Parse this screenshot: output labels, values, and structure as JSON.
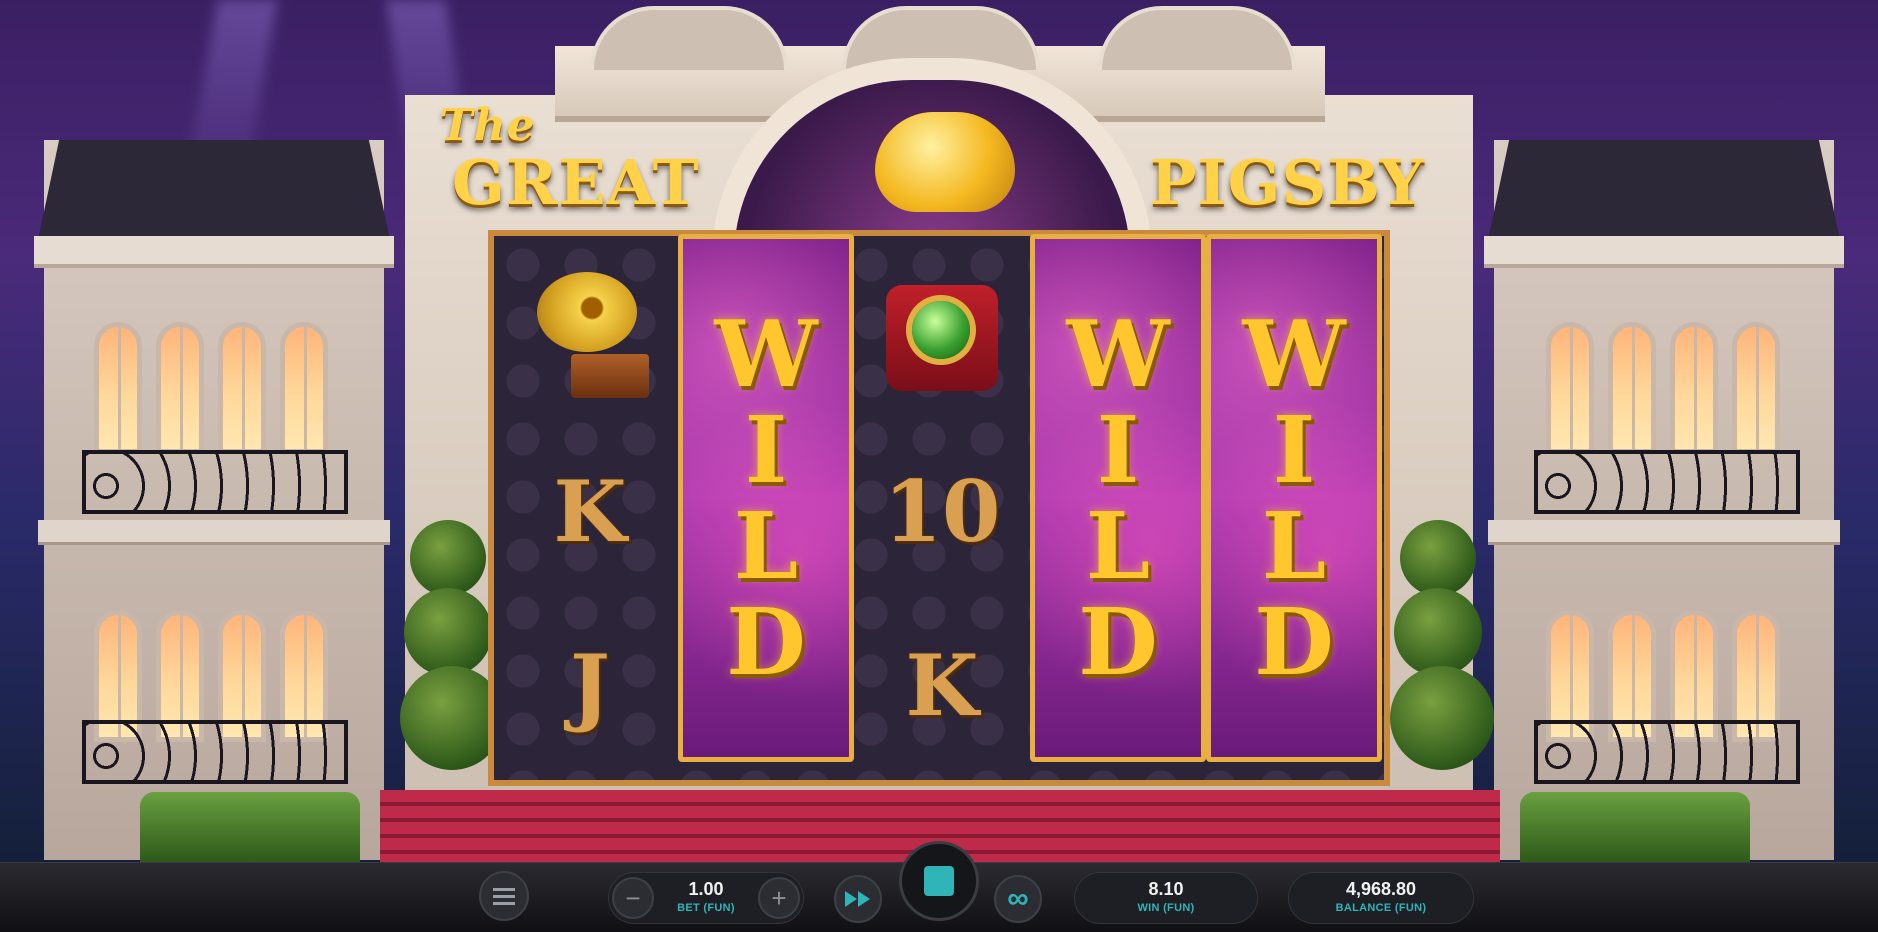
{
  "game": {
    "title_line1": "The",
    "title_line2": "GREAT",
    "title_line3": "PIGSBY"
  },
  "reels": [
    {
      "symbols": [
        "gramophone",
        "K",
        "J"
      ],
      "wild": false
    },
    {
      "symbols": [
        "W",
        "I",
        "L",
        "D"
      ],
      "wild": true
    },
    {
      "symbols": [
        "ring-box",
        "10",
        "K"
      ],
      "wild": false
    },
    {
      "symbols": [
        "W",
        "I",
        "L",
        "D"
      ],
      "wild": true
    },
    {
      "symbols": [
        "W",
        "I",
        "L",
        "D"
      ],
      "wild": true
    }
  ],
  "wild_letters": [
    "W",
    "I",
    "L",
    "D"
  ],
  "controls": {
    "menu_icon": "menu-icon",
    "bet_decrease_glyph": "−",
    "bet_value": "1.00",
    "bet_label": "BET (FUN)",
    "bet_increase_glyph": "+",
    "turbo_icon": "fast-forward-icon",
    "spin_icon": "stop-icon",
    "autoplay_icon": "infinity-icon",
    "win_value": "8.10",
    "win_label": "WIN (FUN)",
    "balance_value": "4,968.80",
    "balance_label": "BALANCE (FUN)"
  },
  "colors": {
    "accent": "#2fb4b8",
    "gold": "#ffc62e",
    "wild_purple": "#9a2ea0"
  }
}
